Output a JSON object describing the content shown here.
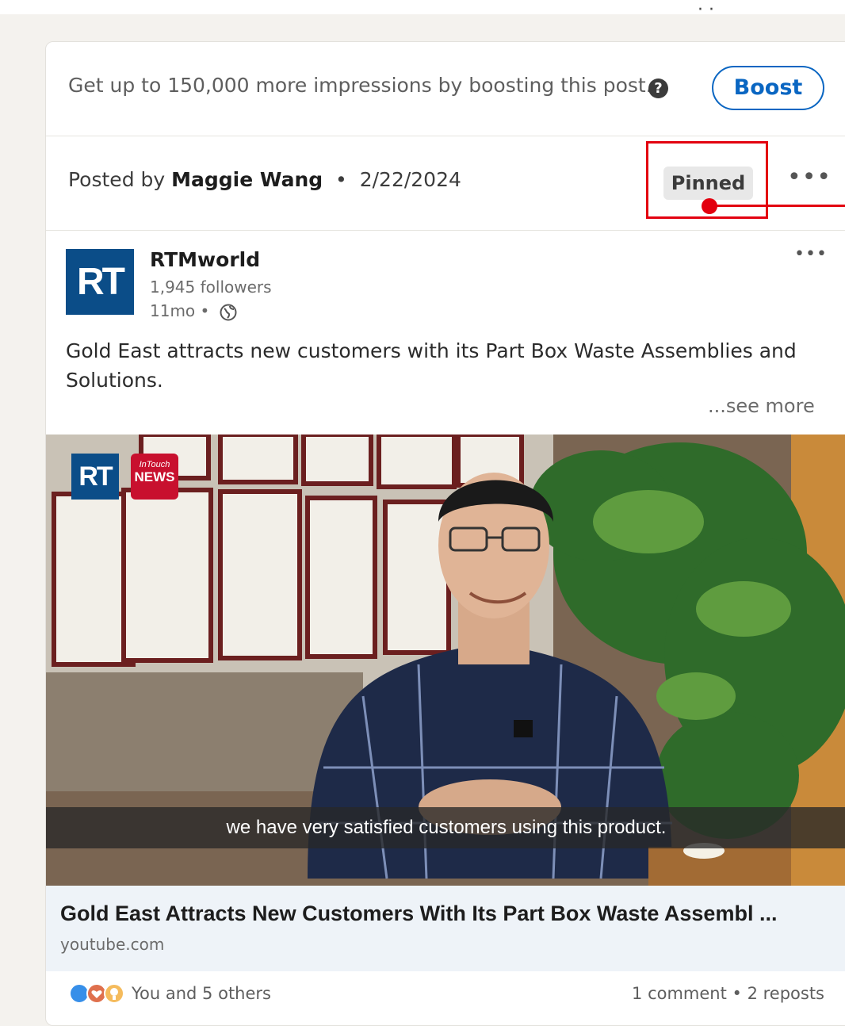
{
  "top_fragment": "· ·",
  "boost": {
    "text": "Get up to 150,000 more impressions by boosting this post.",
    "help_icon": "question-mark",
    "button_label": "Boost"
  },
  "posted": {
    "prefix": "Posted by",
    "author": "Maggie Wang",
    "separator": "•",
    "date": "2/22/2024",
    "pinned_label": "Pinned",
    "more_label": "•••"
  },
  "annotation": {
    "color": "#e3000f"
  },
  "post": {
    "logo_text": "RT",
    "author": "RTMworld",
    "followers": "1,945 followers",
    "age": "11mo •",
    "visibility_icon": "globe",
    "more_label": "•••",
    "text": "Gold East attracts new customers with its Part Box Waste Assemblies and Solutions.",
    "see_more": "...see more"
  },
  "media": {
    "logo_text": "RT",
    "badge_top": "InTouch",
    "badge_bottom": "NEWS",
    "caption": "we have very satisfied customers using this product."
  },
  "link": {
    "title": "Gold East Attracts New Customers With Its Part Box Waste Assembl ...",
    "source": "youtube.com"
  },
  "social": {
    "reactions_text": "You and 5 others",
    "counts_text": "1 comment • 2 reposts",
    "reaction_icons": [
      "clap",
      "heart",
      "insightful"
    ]
  },
  "colors": {
    "accent": "#0a66c2",
    "logo_blue": "#0b4d88",
    "news_red": "#c8102e"
  }
}
